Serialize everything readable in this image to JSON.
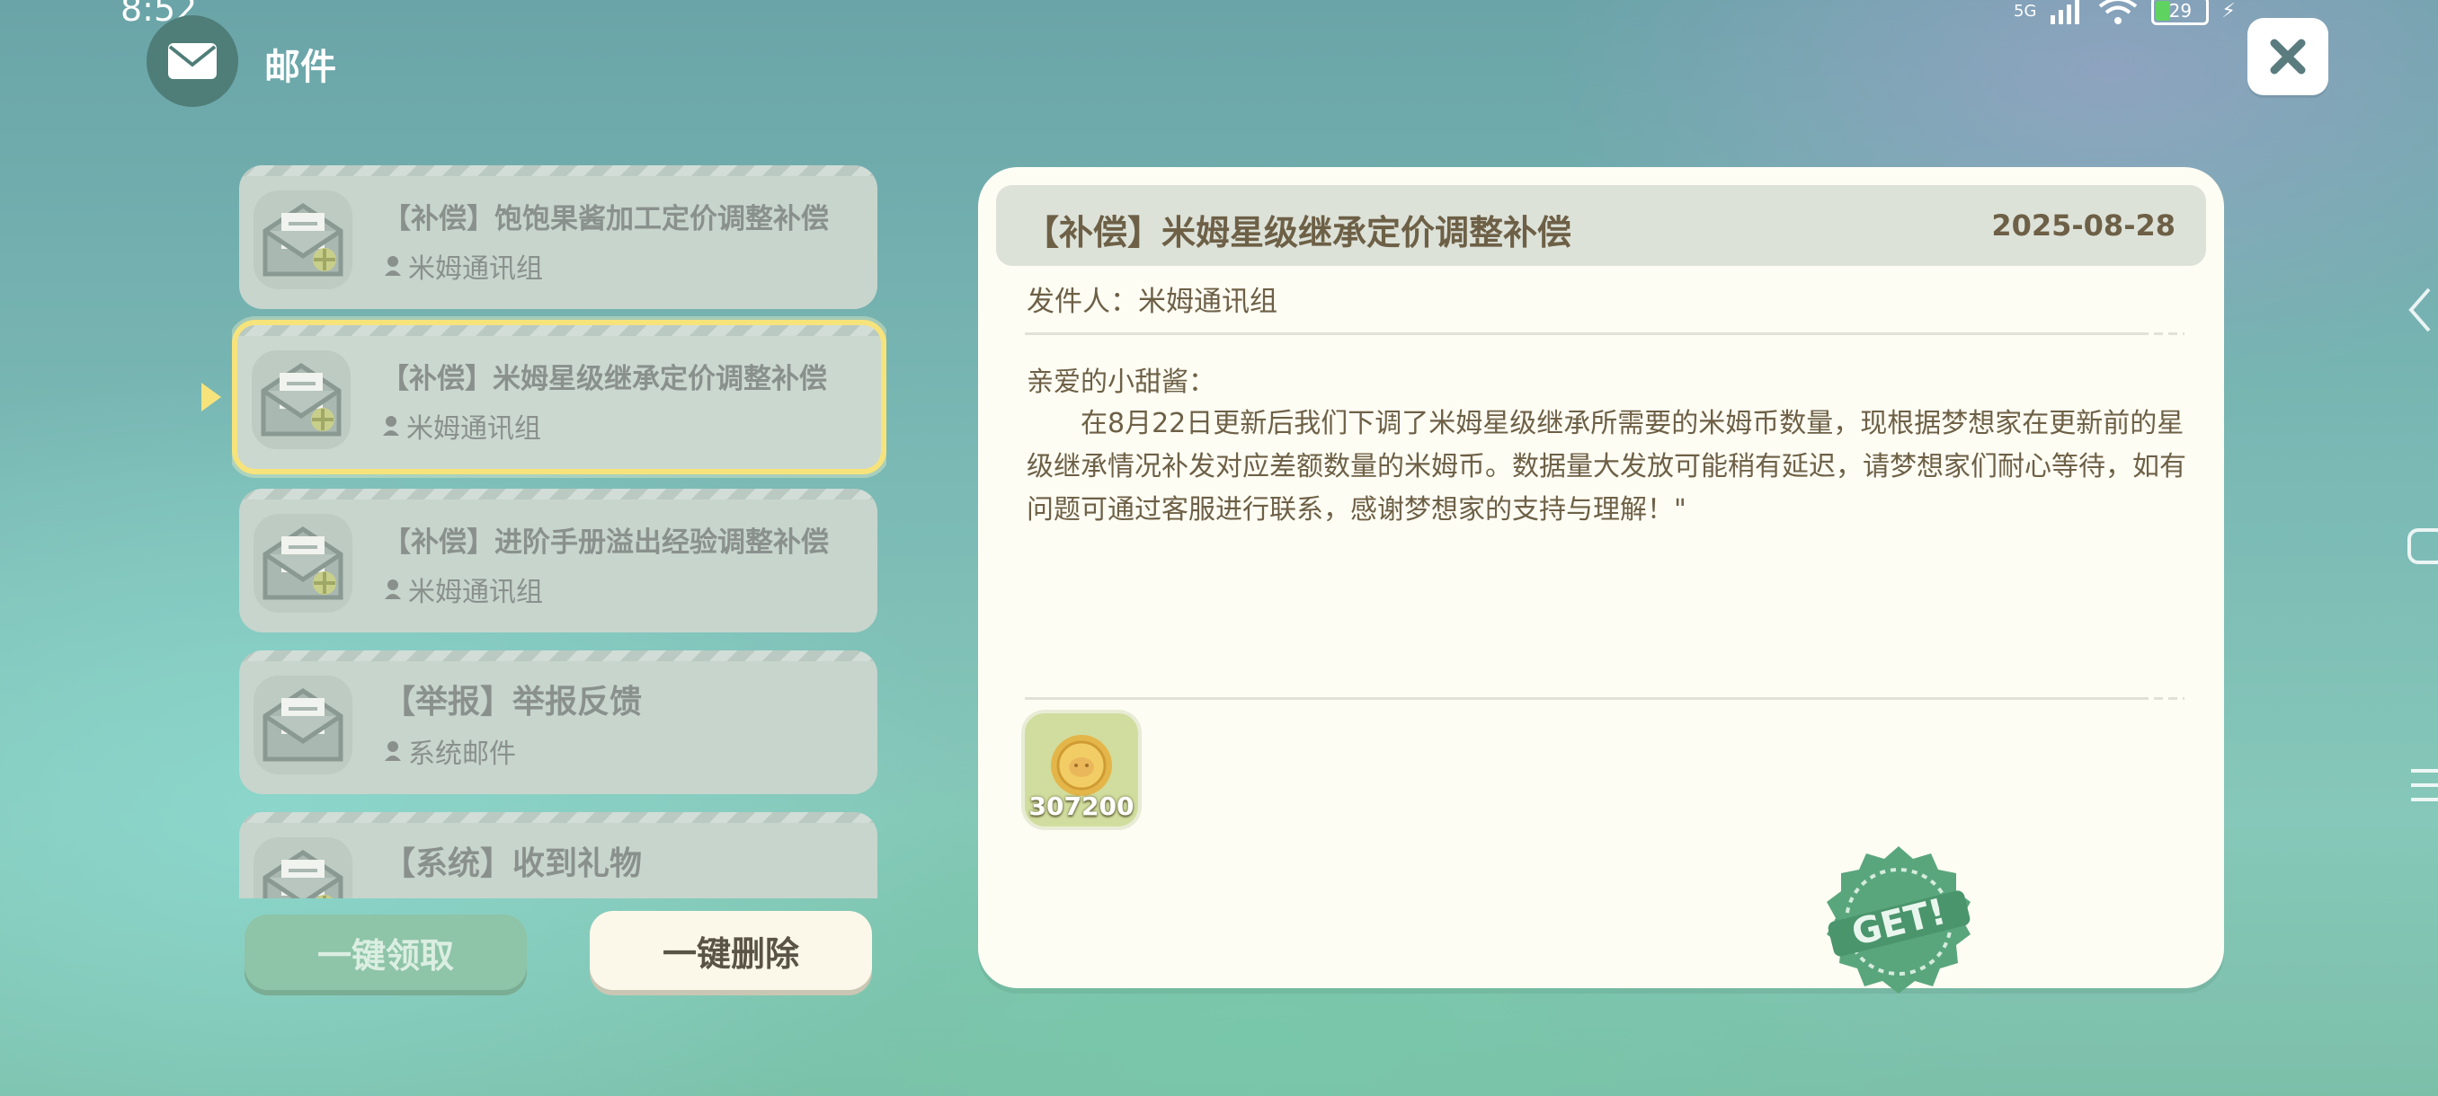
{
  "status_bar": {
    "time": "8:52",
    "network": "5G",
    "battery": "29"
  },
  "header": {
    "title": "邮件",
    "close_icon": "close-icon"
  },
  "mail_list": {
    "items": [
      {
        "title": "【补偿】饱饱果酱加工定价调整补偿",
        "sender": "米姆通讯组",
        "selected": false
      },
      {
        "title": "【补偿】米姆星级继承定价调整补偿",
        "sender": "米姆通讯组",
        "selected": true
      },
      {
        "title": "【补偿】进阶手册溢出经验调整补偿",
        "sender": "米姆通讯组",
        "selected": false
      },
      {
        "title": "【举报】举报反馈",
        "sender": "系统邮件",
        "selected": false
      },
      {
        "title": "【系统】收到礼物",
        "sender": "",
        "selected": false
      }
    ]
  },
  "actions": {
    "claim_all": "一键领取",
    "delete_all": "一键删除"
  },
  "detail": {
    "title": "【补偿】米姆星级继承定价调整补偿",
    "date": "2025-08-28",
    "sender_line": "发件人：米姆通讯组",
    "greeting": "亲爱的小甜酱：",
    "body": "在8月22日更新后我们下调了米姆星级继承所需要的米姆币数量，现根据梦想家在更新前的星级继承情况补发对应差额数量的米姆币。数据量大发放可能稍有延迟，请梦想家们耐心等待，如有问题可通过客服进行联系，感谢梦想家的支持与理解！\"",
    "reward": {
      "icon": "coin-icon",
      "amount": "307200"
    },
    "stamp": "GET!"
  },
  "colors": {
    "accent_selected": "#f6e37b",
    "text_brown": "#6d6046",
    "claim_button": "#8ec4a7",
    "panel_bg": "#fefdf4"
  }
}
